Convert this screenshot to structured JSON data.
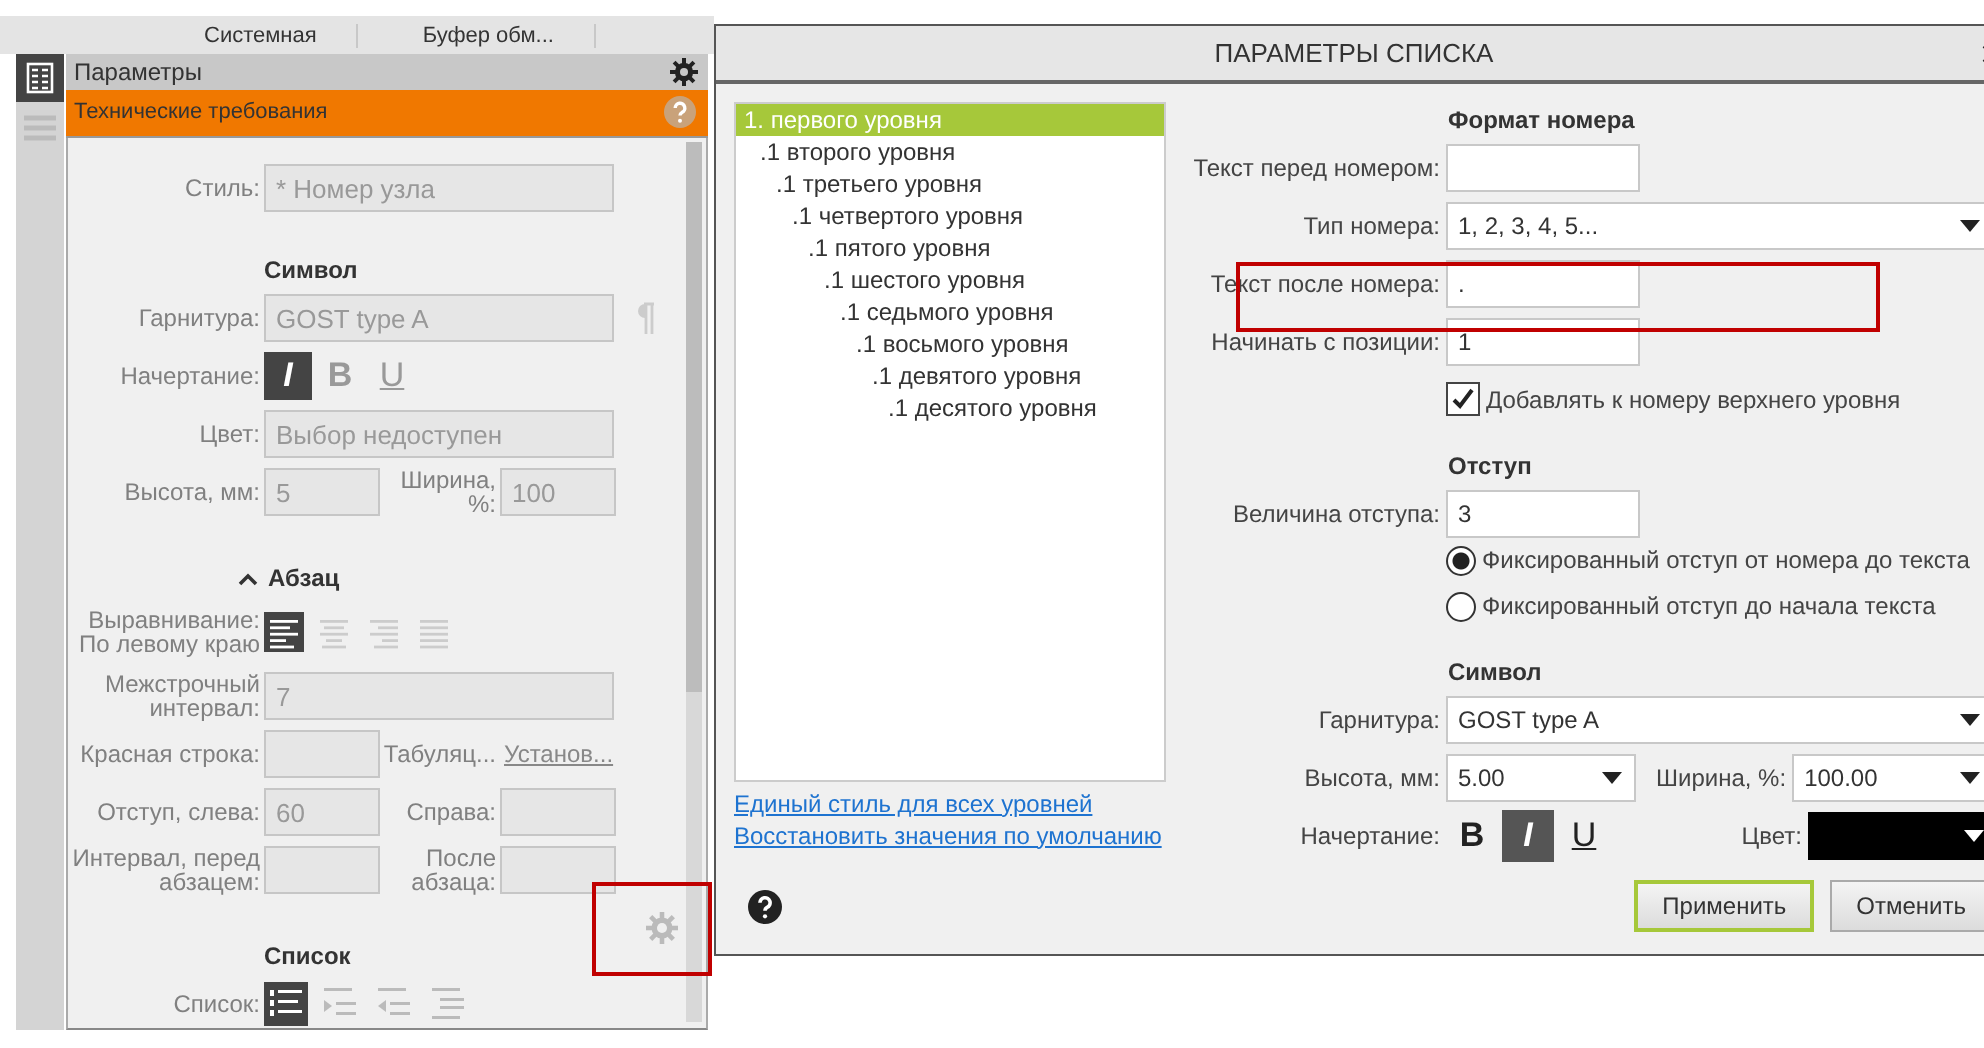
{
  "top_tabs": [
    {
      "label": "Системная"
    },
    {
      "label": "Буфер обм..."
    }
  ],
  "panel": {
    "title": "Параметры",
    "header": "Технические требования",
    "style_label": "Стиль:",
    "style_value": "* Номер узла",
    "symbol": {
      "heading": "Символ",
      "font_label": "Гарнитура:",
      "font_value": "GOST type A",
      "face_label": "Начертание:",
      "faces": [
        {
          "kind": "italic",
          "label": "I",
          "selected": true
        },
        {
          "kind": "bold",
          "label": "B",
          "selected": false
        },
        {
          "kind": "underline",
          "label": "U",
          "selected": false
        }
      ],
      "color_label": "Цвет:",
      "color_value": "Выбор недоступен",
      "height_label": "Высота, мм:",
      "height_value": "5",
      "width_label": "Ширина, %:",
      "width_value": "100"
    },
    "paragraph": {
      "heading": "Абзац",
      "expanded": true,
      "align_label": "Выравнивание:",
      "align_value": "По левому краю",
      "aligns": [
        {
          "kind": "left",
          "selected": true
        },
        {
          "kind": "center",
          "selected": false
        },
        {
          "kind": "right",
          "selected": false
        },
        {
          "kind": "justify",
          "selected": false
        }
      ],
      "line_label": "Межстрочный интервал:",
      "line_value": "7",
      "first_label": "Красная строка:",
      "tab_label": "Табуляц...",
      "tab_link": "Установ...",
      "left_label": "Отступ, слева:",
      "left_value": "60",
      "right_label": "Справа:",
      "before_label": "Интервал, перед абзацем:",
      "after_label": "После абзаца:"
    },
    "list": {
      "heading": "Список",
      "label": "Список:",
      "types": [
        {
          "kind": "numbered",
          "selected": true
        },
        {
          "kind": "indent",
          "selected": false
        },
        {
          "kind": "outdent",
          "selected": false
        },
        {
          "kind": "multilevel",
          "selected": false
        }
      ]
    }
  },
  "dialog": {
    "title": "ПАРАМЕТРЫ СПИСКА",
    "levels": [
      {
        "label": "1. первого уровня",
        "selected": true,
        "children": [
          {
            "label": ".1 второго уровня",
            "selected": false,
            "children": [
              {
                "label": ".1 третьего уровня",
                "selected": false,
                "children": [
                  {
                    "label": ".1 четвертого уровня",
                    "selected": false,
                    "children": [
                      {
                        "label": ".1 пятого уровня",
                        "selected": false,
                        "children": [
                          {
                            "label": ".1 шестого уровня",
                            "selected": false,
                            "children": [
                              {
                                "label": ".1 седьмого уровня",
                                "selected": false,
                                "children": [
                                  {
                                    "label": ".1 восьмого уровня",
                                    "selected": false,
                                    "children": [
                                      {
                                        "label": ".1 девятого уровня",
                                        "selected": false,
                                        "children": [
                                          {
                                            "label": ".1 десятого уровня",
                                            "selected": false
                                          }
                                        ]
                                      }
                                    ]
                                  }
                                ]
                              }
                            ]
                          }
                        ]
                      }
                    ]
                  }
                ]
              }
            ]
          }
        ]
      }
    ],
    "links": [
      "Единый стиль для всех уровней",
      "Восстановить значения по умолчанию"
    ],
    "format": {
      "heading": "Формат номера",
      "before_label": "Текст перед номером:",
      "type_label": "Тип номера:",
      "type_value": "1, 2, 3, 4, 5...",
      "after_label": "Текст после номера:",
      "after_value": ".",
      "start_label": "Начинать с позиции:",
      "start_value": "1",
      "add_upper": {
        "label": "Добавлять к номеру верхнего уровня",
        "checked": true
      }
    },
    "indent": {
      "heading": "Отступ",
      "size_label": "Величина отступа:",
      "size_value": "3",
      "modes": [
        {
          "label": "Фиксированный отступ от номера до текста",
          "selected": true
        },
        {
          "label": "Фиксированный отступ до начала текста",
          "selected": false
        }
      ]
    },
    "symbol": {
      "heading": "Символ",
      "font_label": "Гарнитура:",
      "font_value": "GOST type A",
      "height_label": "Высота, мм:",
      "height_value": "5.00",
      "width_label": "Ширина, %:",
      "width_value": "100.00",
      "face_label": "Начертание:",
      "faces": [
        {
          "kind": "bold",
          "label": "B",
          "selected": false
        },
        {
          "kind": "italic",
          "label": "I",
          "selected": true
        },
        {
          "kind": "underline",
          "label": "U",
          "selected": false
        }
      ],
      "color_label": "Цвет:",
      "color": "#000000"
    },
    "buttons": [
      {
        "label": "Применить",
        "default": true
      },
      {
        "label": "Отменить",
        "default": false
      }
    ]
  }
}
